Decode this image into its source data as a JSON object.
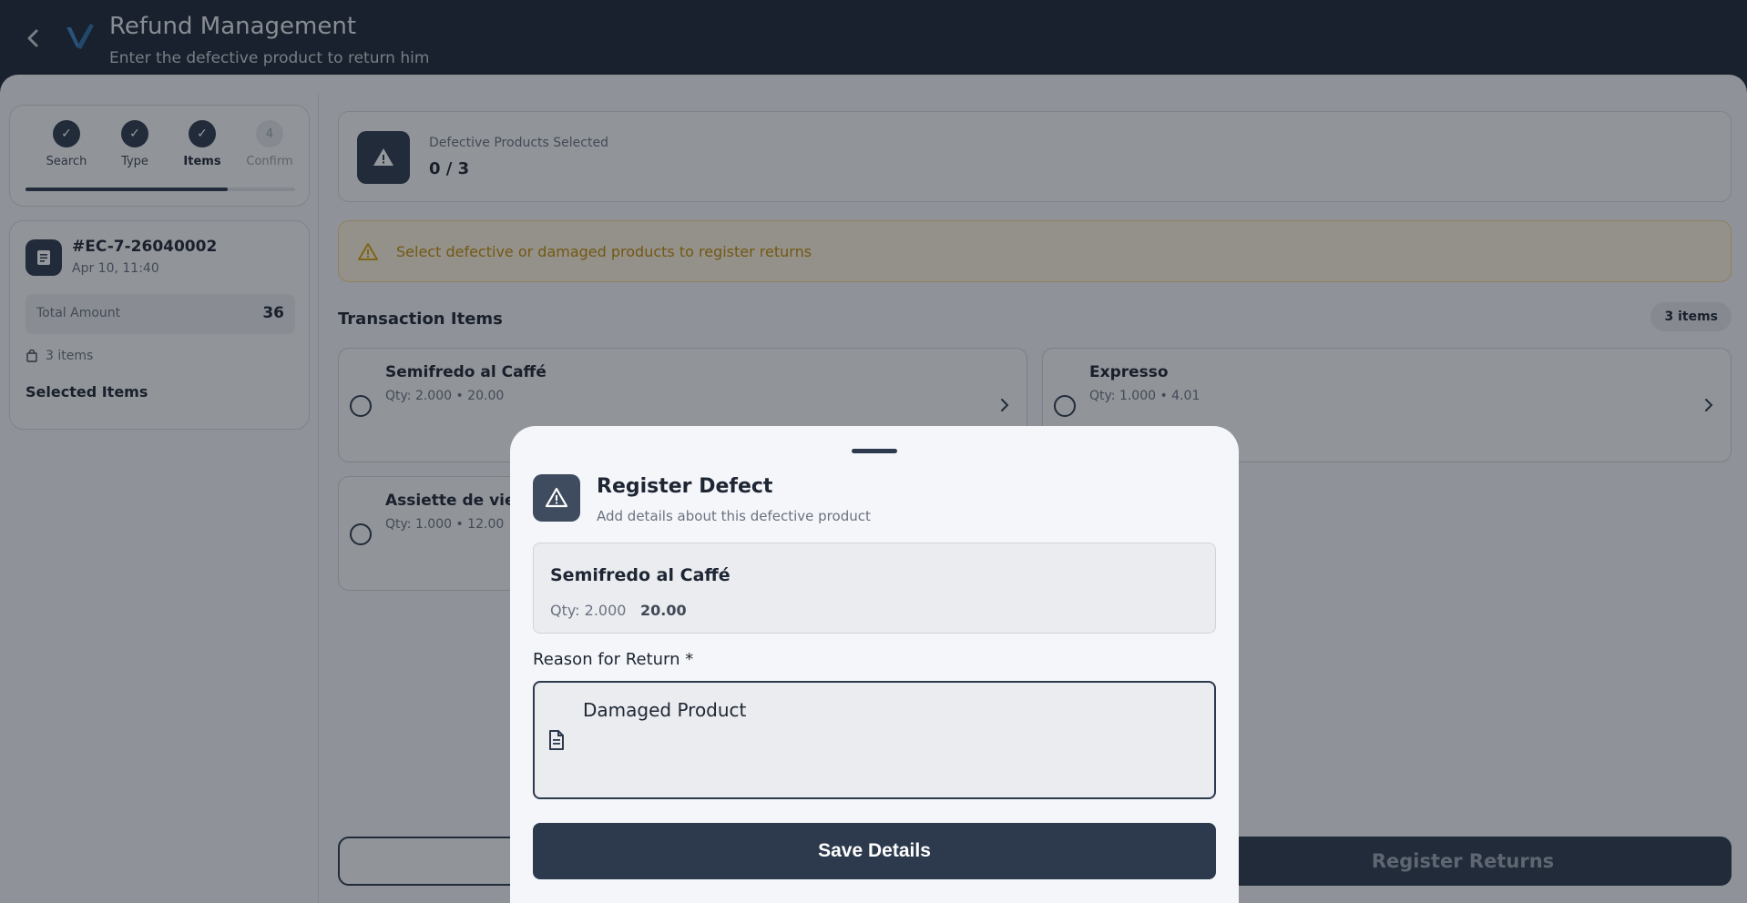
{
  "header": {
    "title": "Refund Management",
    "subtitle": "Enter the defective product to return him"
  },
  "stepper": {
    "steps": [
      {
        "label": "Search",
        "state": "done"
      },
      {
        "label": "Type",
        "state": "done"
      },
      {
        "label": "Items",
        "state": "current"
      },
      {
        "label": "Confirm",
        "state": "pending",
        "number": "4"
      }
    ],
    "progress": 0.75
  },
  "transaction": {
    "id": "#EC-7-26040002",
    "date": "Apr 10, 11:40",
    "total_label": "Total Amount",
    "total_value": "36",
    "items_count": "3 items",
    "selected_items_title": "Selected Items"
  },
  "summary": {
    "label": "Defective Products Selected",
    "value": "0 / 3"
  },
  "alert": {
    "text": "Select defective or damaged products to register returns"
  },
  "items_section": {
    "title": "Transaction Items",
    "badge": "3 items",
    "items": [
      {
        "name": "Semifredo al Caffé",
        "meta": "Qty: 2.000  •  20.00"
      },
      {
        "name": "Expresso",
        "meta": "Qty: 1.000  •  4.01"
      },
      {
        "name": "Assiette de vieux",
        "meta": "Qty: 1.000  •  12.00"
      }
    ]
  },
  "footer": {
    "register_label": "Register Returns"
  },
  "modal": {
    "title": "Register Defect",
    "subtitle": "Add details about this defective product",
    "product_name": "Semifredo al Caffé",
    "product_qty": "Qty: 2.000",
    "product_price": "20.00",
    "reason_label": "Reason for Return *",
    "reason_value": "Damaged Product",
    "save_label": "Save Details"
  },
  "colors": {
    "header_bg": "#1d2736",
    "primary": "#2d3a4d",
    "warning_text": "#c48a07",
    "warning_bg": "#fcf3dd"
  }
}
